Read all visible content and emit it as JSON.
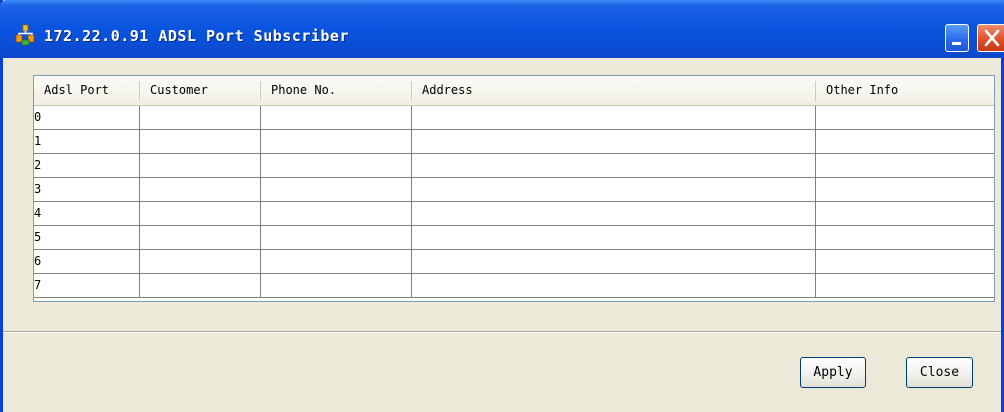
{
  "window": {
    "title": "172.22.0.91 ADSL Port Subscriber",
    "title_bar_color": "#0a55e0",
    "icons": {
      "app": "app-icon",
      "minimize": "minimize-icon",
      "close": "close-icon"
    }
  },
  "table": {
    "columns": [
      "Adsl Port",
      "Customer",
      "Phone No.",
      "Address",
      "Other Info"
    ],
    "rows": [
      [
        "0",
        "",
        "",
        "",
        ""
      ],
      [
        "1",
        "",
        "",
        "",
        ""
      ],
      [
        "2",
        "",
        "",
        "",
        ""
      ],
      [
        "3",
        "",
        "",
        "",
        ""
      ],
      [
        "4",
        "",
        "",
        "",
        ""
      ],
      [
        "5",
        "",
        "",
        "",
        ""
      ],
      [
        "6",
        "",
        "",
        "",
        ""
      ],
      [
        "7",
        "",
        "",
        "",
        ""
      ]
    ]
  },
  "buttons": {
    "apply": "Apply",
    "close": "Close"
  }
}
